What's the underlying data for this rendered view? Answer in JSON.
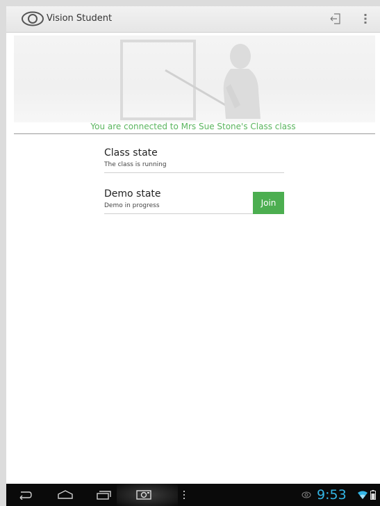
{
  "app": {
    "title": "Vision Student"
  },
  "actionbar": {
    "logout_icon": "logout-icon",
    "overflow_icon": "overflow-menu-icon"
  },
  "status": {
    "connected_message": "You are connected to Mrs Sue Stone's Class class"
  },
  "states": {
    "class": {
      "title": "Class state",
      "subtitle": "The class is running"
    },
    "demo": {
      "title": "Demo state",
      "subtitle": "Demo in progress",
      "join_label": "Join"
    }
  },
  "colors": {
    "accent_green": "#4cae50",
    "message_green": "#5ab55e",
    "clock_blue": "#33b5e5"
  },
  "system_bar": {
    "clock": "9:53"
  }
}
